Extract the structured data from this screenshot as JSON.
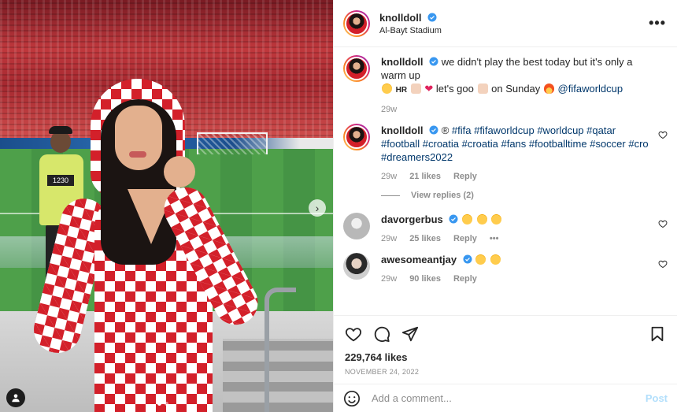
{
  "post": {
    "username": "knolldoll",
    "location": "Al-Bayt Stadium",
    "more_label": "•••"
  },
  "caption": {
    "username": "knolldoll",
    "text_1": "we didn't play the best today but it's only a warm up",
    "text_hr": "HR",
    "text_2": "let's goo",
    "text_3": "on Sunday",
    "mention": "@fifaworldcup",
    "time": "29w"
  },
  "comments": [
    {
      "username": "knolldoll",
      "prefix": "®",
      "hashtags": "#fifa #fifaworldcup #worldcup #qatar #football #croatia #croatia #fans #footballtime #soccer #cro #dreamers2022",
      "time": "29w",
      "likes": "21 likes",
      "reply_label": "Reply",
      "view_replies": "View replies (2)"
    },
    {
      "username": "davorgerbus",
      "time": "29w",
      "likes": "25 likes",
      "reply_label": "Reply",
      "more_label": "•••"
    },
    {
      "username": "awesomeantjay",
      "time": "29w",
      "likes": "90 likes",
      "reply_label": "Reply"
    }
  ],
  "stats": {
    "likes": "229,764 likes",
    "date": "NOVEMBER 24, 2022"
  },
  "compose": {
    "placeholder": "Add a comment...",
    "post_label": "Post"
  },
  "photo": {
    "steward_tag": "1230",
    "next_arrow": "›"
  },
  "colors": {
    "verified": "#3897f0",
    "link": "#00376b",
    "post_button_disabled": "#b2dffc",
    "croatia_red": "#d3202a"
  },
  "icons": [
    "heart-icon",
    "comment-icon",
    "share-icon",
    "bookmark-icon",
    "emoji-icon",
    "verified-icon",
    "user-tag-icon",
    "next-arrow-icon",
    "more-options-icon"
  ]
}
